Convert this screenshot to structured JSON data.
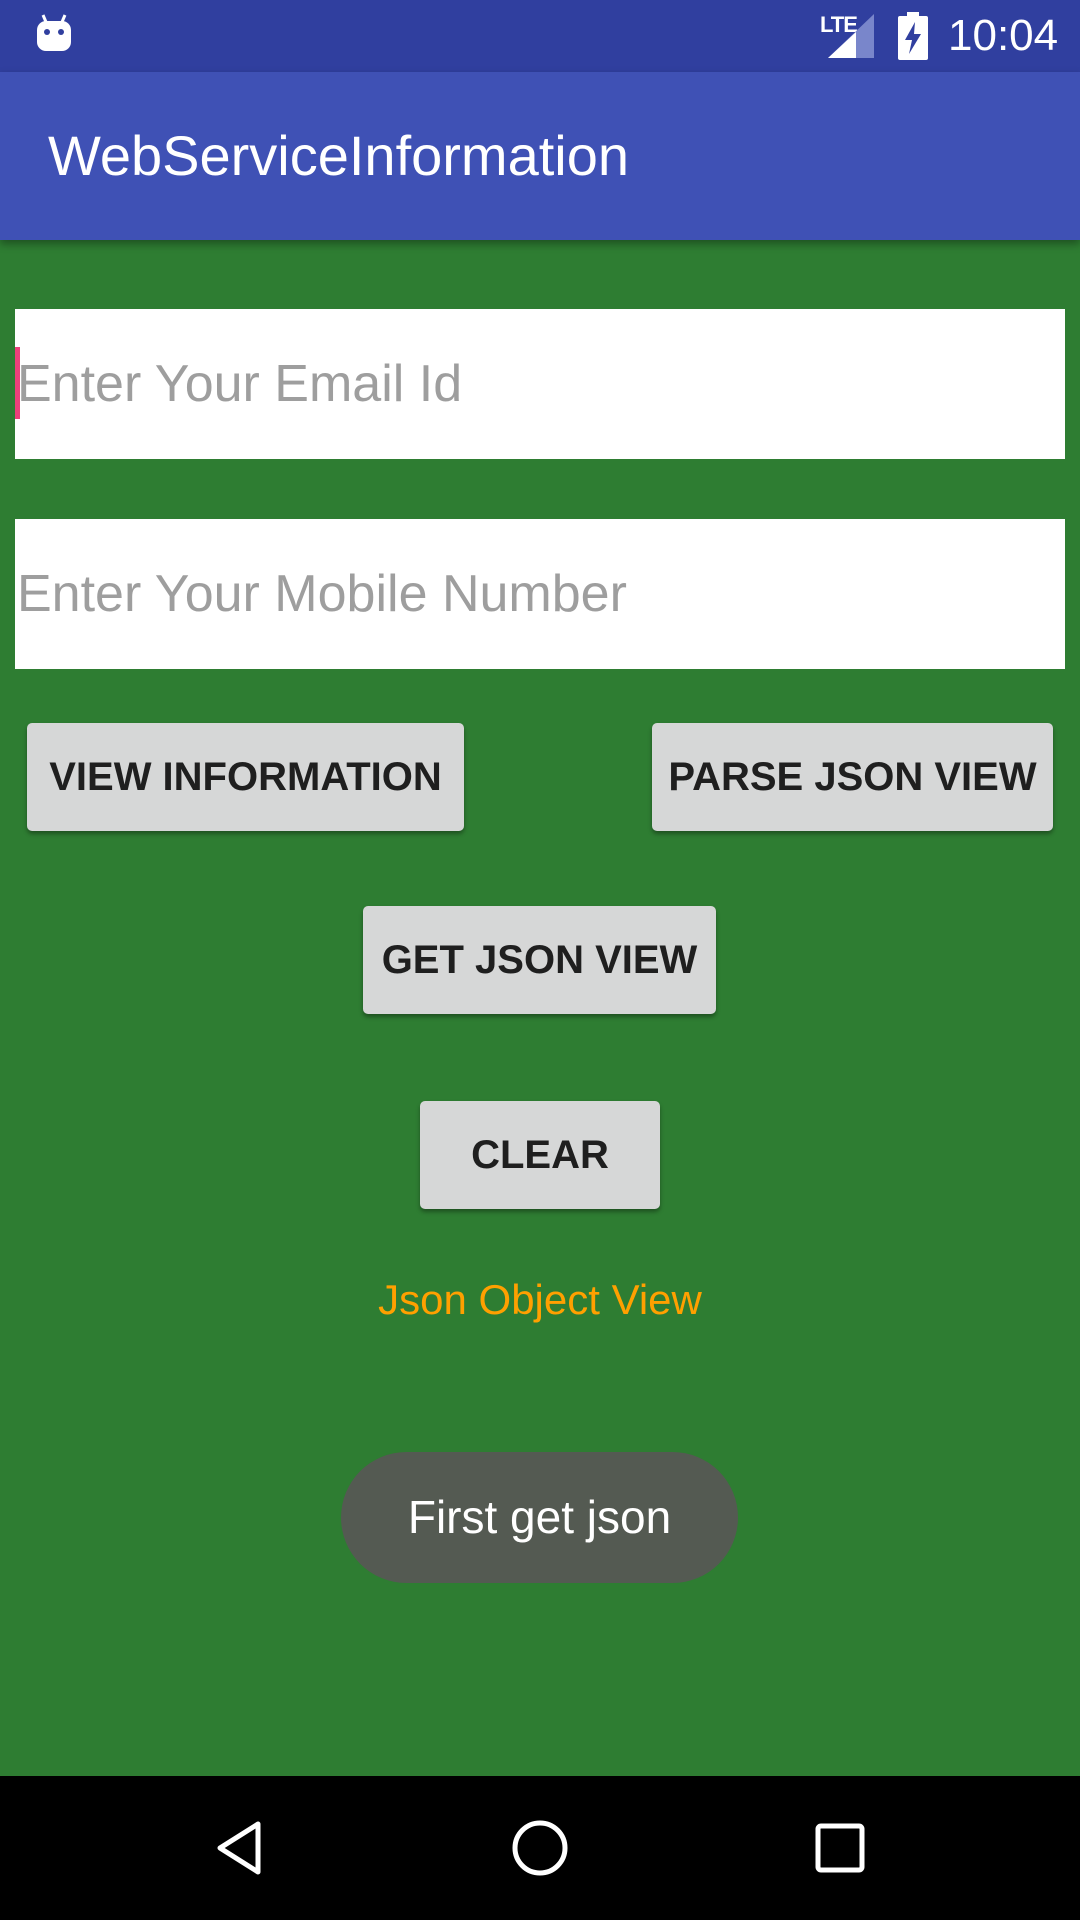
{
  "status_bar": {
    "time": "10:04",
    "network_label": "LTE",
    "icons": [
      "android-icon",
      "signal-icon",
      "battery-charging-icon"
    ]
  },
  "app_bar": {
    "title": "WebServiceInformation"
  },
  "form": {
    "email_placeholder": "Enter Your Email Id",
    "email_value": "",
    "mobile_placeholder": "Enter Your Mobile Number",
    "mobile_value": ""
  },
  "buttons": {
    "view_information": "VIEW INFORMATION",
    "parse_json_view": "PARSE JSON VIEW",
    "get_json_view": "GET JSON VIEW",
    "clear": "CLEAR"
  },
  "json_object_view": "Json Object View",
  "toast": "First get json",
  "nav_bar": {
    "icons": [
      "back-icon",
      "home-icon",
      "recents-icon"
    ]
  },
  "colors": {
    "status_bar": "#303f9f",
    "app_bar": "#3f51b5",
    "background": "#2e7d32",
    "accent_cursor": "#ec407a",
    "json_label": "#ffa000",
    "button": "#d6d7d7",
    "toast": "#545a52"
  }
}
